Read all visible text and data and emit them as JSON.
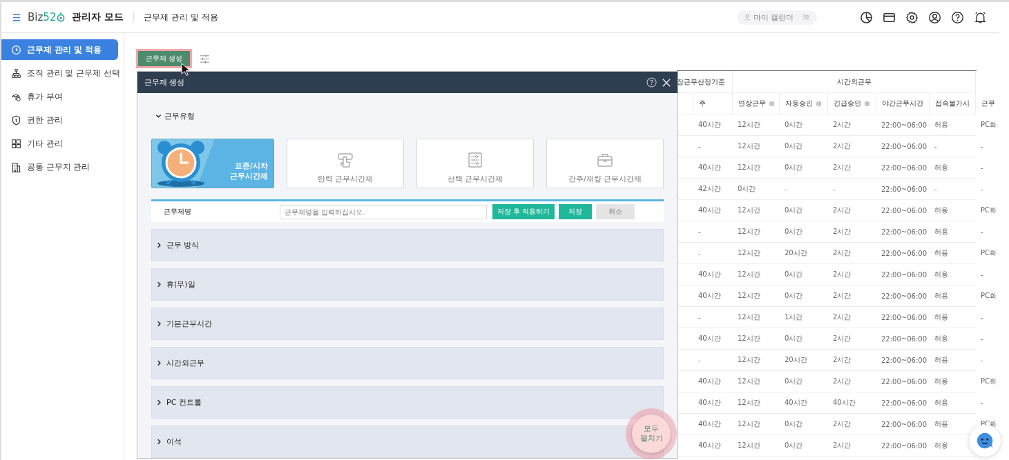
{
  "header": {
    "logo": "Biz52",
    "mode": "관리자 모드",
    "page_title": "근무제 관리 및 적용",
    "calendar_button": "마이 캘린더"
  },
  "sidebar": {
    "items": [
      {
        "label": "근무제 관리 및 적용",
        "selected": true
      },
      {
        "label": "조직 관리 및 근무제 선택",
        "selected": false
      },
      {
        "label": "휴가 부여",
        "selected": false
      },
      {
        "label": "권한 관리",
        "selected": false
      },
      {
        "label": "기타 관리",
        "selected": false
      },
      {
        "label": "공통 근무지 관리",
        "selected": false
      }
    ]
  },
  "toolbar": {
    "create_button": "근무제 생성"
  },
  "table": {
    "group_headers": [
      "장근무산정기준",
      "시간외근무"
    ],
    "columns": [
      {
        "label": "주",
        "info": false
      },
      {
        "label": "연장근무",
        "info": true
      },
      {
        "label": "자동승인",
        "info": true
      },
      {
        "label": "긴급승인",
        "info": true
      },
      {
        "label": "야간근무시간",
        "info": false
      },
      {
        "label": "접속불가시",
        "info": false
      },
      {
        "label": "근무",
        "info": false
      }
    ],
    "rows": [
      [
        "40시간",
        "12시간",
        "0시간",
        "2시간",
        "22:00~06:00",
        "허용",
        "PC화"
      ],
      [
        "-",
        "12시간",
        "0시간",
        "2시간",
        "22:00~06:00",
        "-",
        "-"
      ],
      [
        "40시간",
        "12시간",
        "0시간",
        "2시간",
        "22:00~06:00",
        "허용",
        "-"
      ],
      [
        "42시간",
        "0시간",
        "-",
        "-",
        "22:00~06:00",
        "-",
        "-"
      ],
      [
        "40시간",
        "12시간",
        "0시간",
        "2시간",
        "22:00~06:00",
        "허용",
        "PC화"
      ],
      [
        "-",
        "12시간",
        "0시간",
        "2시간",
        "22:00~06:00",
        "허용",
        "-"
      ],
      [
        "-",
        "12시간",
        "20시간",
        "2시간",
        "22:00~06:00",
        "허용",
        "PC화"
      ],
      [
        "40시간",
        "12시간",
        "0시간",
        "2시간",
        "22:00~06:00",
        "허용",
        "-"
      ],
      [
        "40시간",
        "12시간",
        "0시간",
        "2시간",
        "22:00~06:00",
        "허용",
        "PC화"
      ],
      [
        "-",
        "12시간",
        "1시간",
        "2시간",
        "22:00~06:00",
        "허용",
        "-"
      ],
      [
        "40시간",
        "12시간",
        "0시간",
        "2시간",
        "22:00~06:00",
        "허용",
        "-"
      ],
      [
        "-",
        "12시간",
        "20시간",
        "2시간",
        "22:00~06:00",
        "허용",
        "-"
      ],
      [
        "40시간",
        "12시간",
        "0시간",
        "2시간",
        "22:00~06:00",
        "허용",
        "PC화"
      ],
      [
        "40시간",
        "12시간",
        "40시간",
        "40시간",
        "22:00~06:00",
        "허용",
        "-"
      ],
      [
        "40시간",
        "12시간",
        "0시간",
        "2시간",
        "22:00~06:00",
        "허용",
        "PC화"
      ],
      [
        "40시간",
        "12시간",
        "0시간",
        "2시간",
        "22:00~06:00",
        "허용"
      ]
    ]
  },
  "modal": {
    "title": "근무제 생성",
    "section_title": "근무유형",
    "types": [
      {
        "label": "표준/시차 근무시간제",
        "selected": true
      },
      {
        "label": "탄력 근무시간제",
        "selected": false
      },
      {
        "label": "선택 근무시간제",
        "selected": false
      },
      {
        "label": "간주/재량 근무시간제",
        "selected": false
      }
    ],
    "name_label": "근무제명",
    "name_placeholder": "근무제명을 입력하십시오.",
    "buttons": [
      {
        "label": "저장 후 적용하기",
        "kind": "primary"
      },
      {
        "label": "저장",
        "kind": "primary"
      },
      {
        "label": "취소",
        "kind": "secondary"
      }
    ],
    "sections": [
      {
        "label": "근무 방식",
        "expanded": false
      },
      {
        "label": "휴(무)일",
        "expanded": false
      },
      {
        "label": "기본근무시간",
        "expanded": false
      },
      {
        "label": "시간외근무",
        "expanded": false
      },
      {
        "label": "PC 컨트롤",
        "expanded": false
      },
      {
        "label": "이석",
        "expanded": false
      }
    ],
    "expand_all": "모두 펼치기"
  }
}
